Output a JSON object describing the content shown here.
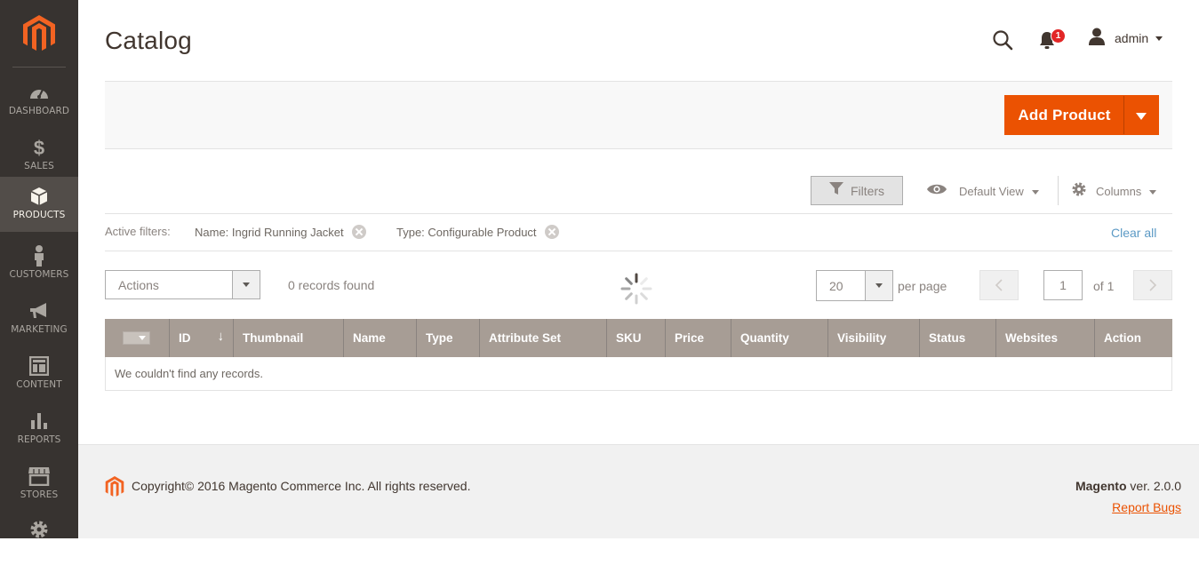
{
  "brand": {
    "accent": "#eb5202",
    "sidebar_bg": "#373330",
    "sidebar_active_bg": "#524d49",
    "grid_header_bg": "#a79d95",
    "link_color": "#5c9ac5"
  },
  "sidebar": {
    "logo": "magento-logo",
    "items": [
      {
        "label": "DASHBOARD",
        "icon": "dashboard-icon",
        "active": false
      },
      {
        "label": "SALES",
        "icon": "dollar-icon",
        "active": false
      },
      {
        "label": "PRODUCTS",
        "icon": "cube-icon",
        "active": true
      },
      {
        "label": "CUSTOMERS",
        "icon": "person-icon",
        "active": false
      },
      {
        "label": "MARKETING",
        "icon": "megaphone-icon",
        "active": false
      },
      {
        "label": "CONTENT",
        "icon": "layout-icon",
        "active": false
      },
      {
        "label": "REPORTS",
        "icon": "bar-chart-icon",
        "active": false
      },
      {
        "label": "STORES",
        "icon": "storefront-icon",
        "active": false
      },
      {
        "label": "",
        "icon": "gear-icon",
        "active": false
      }
    ]
  },
  "header": {
    "title": "Catalog",
    "notifications_count": "1",
    "user": "admin"
  },
  "page_actions": {
    "add_product": "Add Product"
  },
  "toolbar": {
    "filters": "Filters",
    "view": "Default View",
    "columns": "Columns"
  },
  "active_filters": {
    "label": "Active filters:",
    "chips": [
      "Name: Ingrid Running Jacket",
      "Type: Configurable Product"
    ],
    "clear_all": "Clear all"
  },
  "listing": {
    "actions_label": "Actions",
    "records_found": "0 records found",
    "per_page_value": "20",
    "per_page_label": "per page",
    "current_page": "1",
    "page_of": "of 1"
  },
  "grid": {
    "columns": [
      "ID",
      "Thumbnail",
      "Name",
      "Type",
      "Attribute Set",
      "SKU",
      "Price",
      "Quantity",
      "Visibility",
      "Status",
      "Websites",
      "Action"
    ],
    "sort_indicator": "↓",
    "empty_message": "We couldn't find any records."
  },
  "footer": {
    "copyright": "Copyright© 2016 Magento Commerce Inc. All rights reserved.",
    "product": "Magento",
    "version": " ver. 2.0.0",
    "report_bugs": "Report Bugs"
  }
}
